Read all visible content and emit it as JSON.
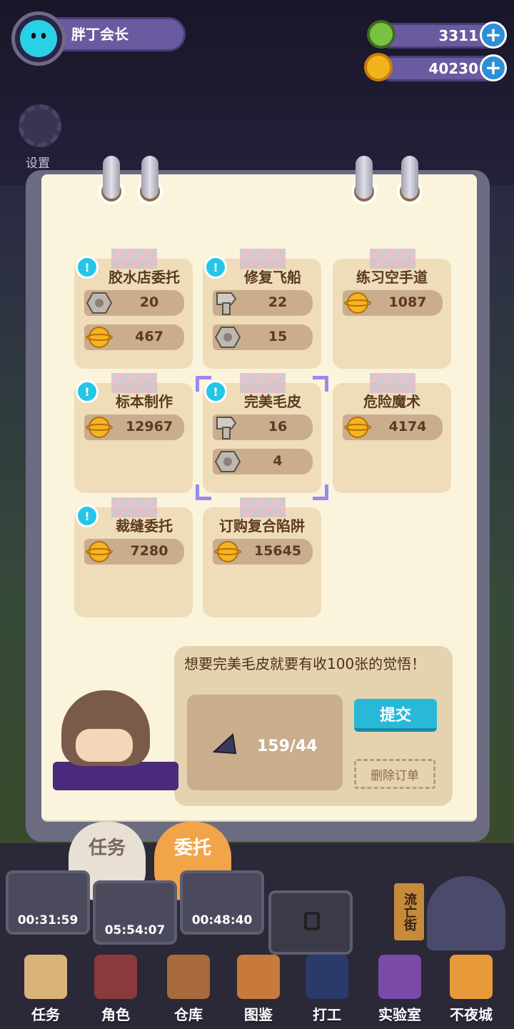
{
  "player": {
    "name": "胖丁会长"
  },
  "sidebar": {
    "settings_label": "设置"
  },
  "currencies": [
    {
      "icon": "green-gear-coin-icon",
      "value": "3311",
      "color": "#7ac043"
    },
    {
      "icon": "gold-planet-coin-icon",
      "value": "40230",
      "color": "#f2b21c"
    }
  ],
  "tasks": [
    {
      "title": "胶水店委托",
      "alert": true,
      "requirements": [
        {
          "icon": "nut-icon",
          "value": "20"
        },
        {
          "icon": "gold-coin-icon",
          "value": "467"
        }
      ]
    },
    {
      "title": "修复飞船",
      "alert": true,
      "requirements": [
        {
          "icon": "bolt-icon",
          "value": "22"
        },
        {
          "icon": "nut-icon",
          "value": "15"
        }
      ]
    },
    {
      "title": "练习空手道",
      "alert": false,
      "requirements": [
        {
          "icon": "gold-coin-icon",
          "value": "1087"
        }
      ]
    },
    {
      "title": "标本制作",
      "alert": true,
      "requirements": [
        {
          "icon": "gold-coin-icon",
          "value": "12967"
        }
      ]
    },
    {
      "title": "完美毛皮",
      "alert": true,
      "selected": true,
      "requirements": [
        {
          "icon": "bolt-icon",
          "value": "16"
        },
        {
          "icon": "nut-icon",
          "value": "4"
        }
      ]
    },
    {
      "title": "危险魔术",
      "alert": false,
      "requirements": [
        {
          "icon": "gold-coin-icon",
          "value": "4174"
        }
      ]
    },
    {
      "title": "裁缝委托",
      "alert": true,
      "requirements": [
        {
          "icon": "gold-coin-icon",
          "value": "7280"
        }
      ]
    },
    {
      "title": "订购复合陷阱",
      "alert": false,
      "requirements": [
        {
          "icon": "gold-coin-icon",
          "value": "15645"
        }
      ]
    }
  ],
  "detail": {
    "description": "想要完美毛皮就要有收100张的觉悟！",
    "item_icon": "fur-item-icon",
    "item_count": "159/44",
    "submit_label": "提交",
    "delete_label": "删除订单"
  },
  "tabs": {
    "task_label": "任务",
    "commission_label": "委托"
  },
  "timers": [
    "00:31:59",
    "05:54:07",
    "00:48:40"
  ],
  "street_sign": "流亡街",
  "bottom_nav": [
    {
      "label": "任务",
      "icon": "clipboard-icon"
    },
    {
      "label": "角色",
      "icon": "character-icon"
    },
    {
      "label": "仓库",
      "icon": "chest-icon"
    },
    {
      "label": "图鉴",
      "icon": "book-icon"
    },
    {
      "label": "打工",
      "icon": "work-tv-icon"
    },
    {
      "label": "实验室",
      "icon": "lab-flask-icon"
    },
    {
      "label": "不夜城",
      "icon": "city-cat-icon"
    }
  ]
}
